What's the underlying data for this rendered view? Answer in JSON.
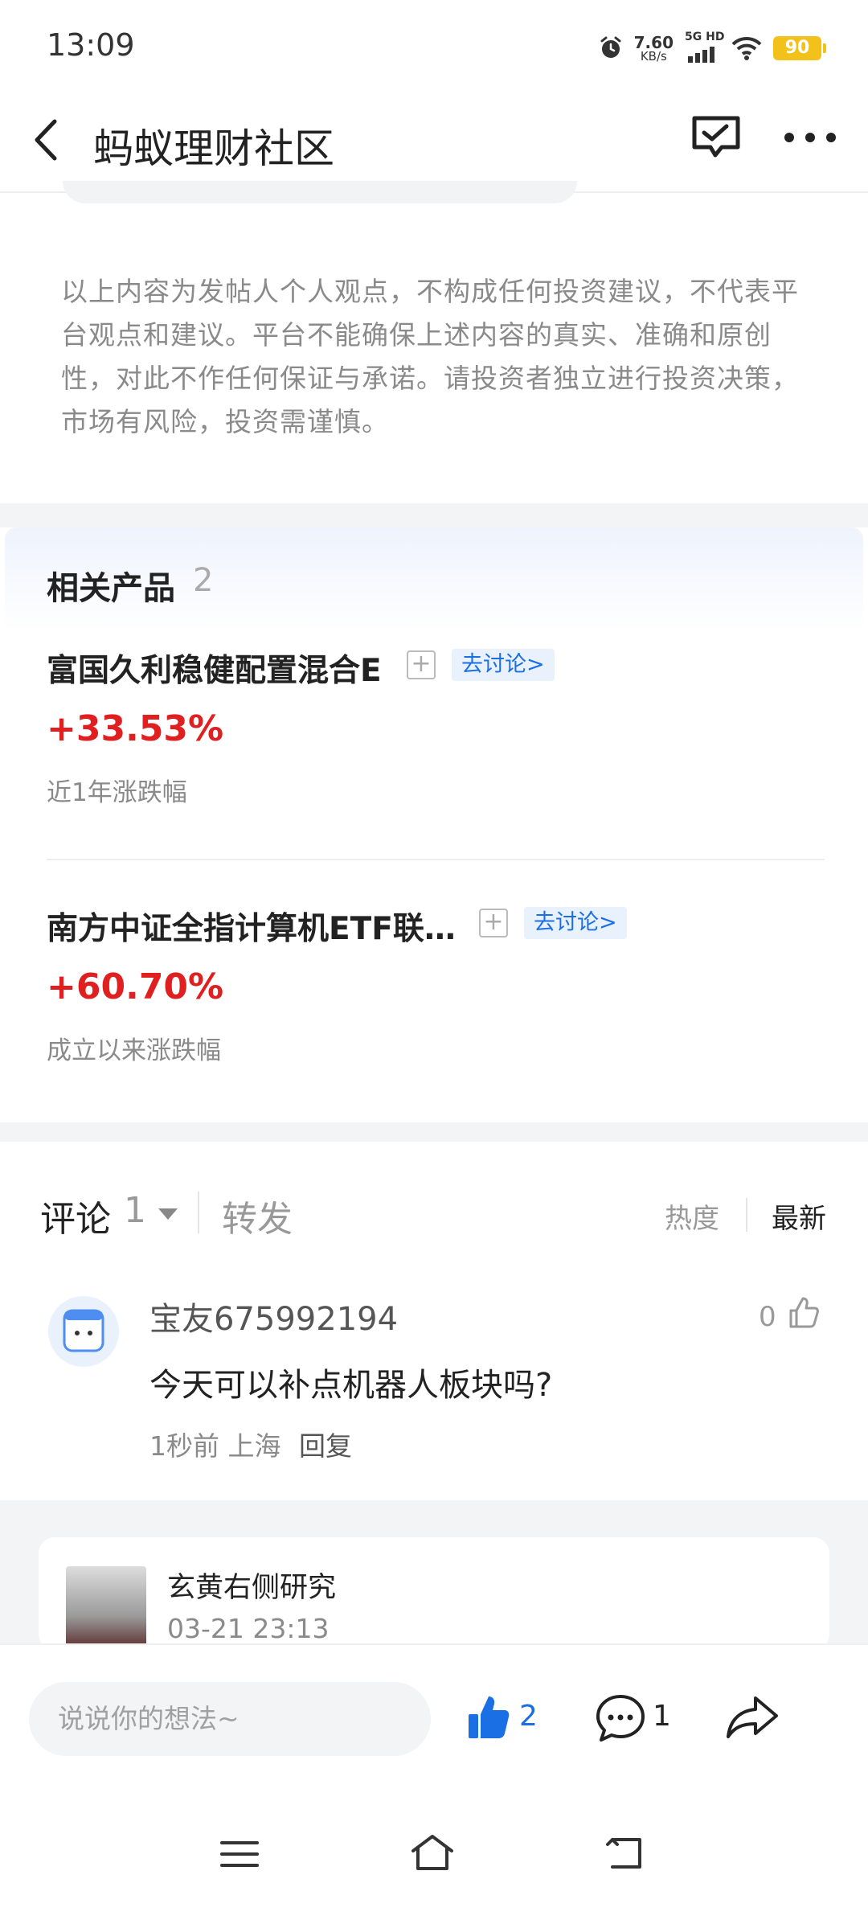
{
  "status_bar": {
    "time": "13:09",
    "net_speed_value": "7.60",
    "net_speed_unit": "KB/s",
    "network_label": "5G HD",
    "battery": "90",
    "icons": [
      "alarm-icon",
      "signal-icon",
      "wifi-icon",
      "battery-icon"
    ]
  },
  "nav": {
    "title": "蚂蚁理财社区",
    "icons": [
      "back-icon",
      "message-icon",
      "more-icon"
    ]
  },
  "disclaimer": "以上内容为发帖人个人观点，不构成任何投资建议，不代表平台观点和建议。平台不能确保上述内容的真实、准确和原创性，对此不作任何保证与承诺。请投资者独立进行投资决策，市场有风险，投资需谨慎。",
  "related_products": {
    "title": "相关产品",
    "count": "2",
    "items": [
      {
        "name": "富国久利稳健配置混合E",
        "discuss_label": "去讨论>",
        "change": "+33.53%",
        "change_label": "近1年涨跌幅"
      },
      {
        "name": "南方中证全指计算机ETF联…",
        "discuss_label": "去讨论>",
        "change": "+60.70%",
        "change_label": "成立以来涨跌幅"
      }
    ]
  },
  "comments": {
    "tab_comments": "评论",
    "comment_count": "1",
    "tab_forward": "转发",
    "sort_hot": "热度",
    "sort_new": "最新",
    "items": [
      {
        "user": "宝友675992194",
        "text": "今天可以补点机器人板块吗?",
        "meta": "1秒前  上海",
        "reply_label": "回复",
        "likes": "0"
      }
    ]
  },
  "forward_card": {
    "name": "玄黄右侧研究",
    "date": "03-21 23:13"
  },
  "action_bar": {
    "input_placeholder": "说说你的想法~",
    "like_count": "2",
    "comment_count": "1"
  },
  "colors": {
    "accent": "#1b6fe4",
    "gain": "#e02020",
    "battery": "#f2c21a"
  }
}
